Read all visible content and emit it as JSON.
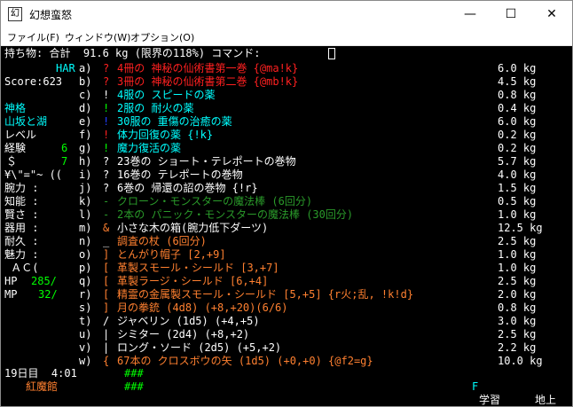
{
  "window": {
    "title": "幻想蛮怒",
    "icon": "app-icon"
  },
  "window_buttons": {
    "minimize": "—",
    "maximize": "☐",
    "close": "✕"
  },
  "menu": [
    "ファイル(F)",
    "ウィンドウ(W)",
    "オプション(O)"
  ],
  "header": {
    "text": "持ち物: 合計  91.6 kg (限界の118%) コマンド:"
  },
  "sidebar": {
    "race": "HAR",
    "score": "Score:623",
    "title": "神格",
    "name": "山坂と湖",
    "level_label": "レベル",
    "exp_label": "経験",
    "exp_value": "6",
    "gold_label": "＄",
    "gold_value": "7",
    "equip_chars": "¥\\\"=\"~ ((",
    "stats": [
      "腕力 :",
      "知能 :",
      "賢さ :",
      "器用 :",
      "耐久 :",
      "魅力 :"
    ],
    "ac_label": " ＡＣ(",
    "hp_label": "HP",
    "hp_value": "285/",
    "mp_label": "MP",
    "mp_value": "32/",
    "day": "19日目  4:01",
    "location": "紅魔館"
  },
  "inventory": [
    {
      "letter": "a)",
      "sym": "?",
      "sc": "rd",
      "name": "4冊の 神秘の仙術書第一巻 {@ma!k}",
      "nc": "rd",
      "weight": "6.0 kg"
    },
    {
      "letter": "b)",
      "sym": "?",
      "sc": "rd",
      "name": "3冊の 神秘の仙術書第二巻 {@mb!k}",
      "nc": "rd",
      "weight": "4.5 kg"
    },
    {
      "letter": "c)",
      "sym": "!",
      "sc": "w",
      "name": "4服の スピードの薬",
      "nc": "cy",
      "weight": "0.8 kg"
    },
    {
      "letter": "d)",
      "sym": "!",
      "sc": "gn",
      "name": "2服の 耐火の薬",
      "nc": "cy",
      "weight": "0.4 kg"
    },
    {
      "letter": "e)",
      "sym": "!",
      "sc": "bl",
      "name": "30服の 重傷の治癒の薬",
      "nc": "cy",
      "weight": "6.0 kg"
    },
    {
      "letter": "f)",
      "sym": "!",
      "sc": "rd",
      "name": "体力回復の薬 {!k}",
      "nc": "cy",
      "weight": "0.2 kg"
    },
    {
      "letter": "g)",
      "sym": "!",
      "sc": "gn",
      "name": "魔力復活の薬",
      "nc": "cy",
      "weight": "0.2 kg"
    },
    {
      "letter": "h)",
      "sym": "?",
      "sc": "w",
      "name": "23巻の ショート・テレポートの巻物",
      "nc": "w",
      "weight": "5.7 kg"
    },
    {
      "letter": "i)",
      "sym": "?",
      "sc": "w",
      "name": "16巻の テレポートの巻物",
      "nc": "w",
      "weight": "4.0 kg"
    },
    {
      "letter": "j)",
      "sym": "?",
      "sc": "w",
      "name": "6巻の 帰還の詔の巻物 {!r}",
      "nc": "w",
      "weight": "1.5 kg"
    },
    {
      "letter": "k)",
      "sym": "-",
      "sc": "dg",
      "name": "クローン・モンスターの魔法棒 (6回分)",
      "nc": "dg",
      "weight": "0.5 kg"
    },
    {
      "letter": "l)",
      "sym": "-",
      "sc": "dg",
      "name": "2本の パニック・モンスターの魔法棒 (30回分)",
      "nc": "dg",
      "weight": "1.0 kg"
    },
    {
      "letter": "m)",
      "sym": "&",
      "sc": "or",
      "name": "小さな木の箱(腕力低下ダーツ)",
      "nc": "w",
      "weight": "12.5 kg"
    },
    {
      "letter": "n)",
      "sym": "_",
      "sc": "w",
      "name": "調査の杖 (6回分)",
      "nc": "or",
      "weight": "2.5 kg"
    },
    {
      "letter": "o)",
      "sym": "]",
      "sc": "or",
      "name": "とんがり帽子 [2,+9]",
      "nc": "or",
      "weight": "1.0 kg"
    },
    {
      "letter": "p)",
      "sym": "[",
      "sc": "or",
      "name": "革製スモール・シールド [3,+7]",
      "nc": "or",
      "weight": "1.0 kg"
    },
    {
      "letter": "q)",
      "sym": "[",
      "sc": "or",
      "name": "革製ラージ・シールド [6,+4]",
      "nc": "or",
      "weight": "2.5 kg"
    },
    {
      "letter": "r)",
      "sym": "[",
      "sc": "or",
      "name": "精霊の金属製スモール・シールド [5,+5] {r火;乱, !k!d}",
      "nc": "or",
      "weight": "2.0 kg"
    },
    {
      "letter": "s)",
      "sym": "]",
      "sc": "or",
      "name": "月の拳銃 (4d8) (+8,+20)(6/6)",
      "nc": "or",
      "weight": "0.8 kg"
    },
    {
      "letter": "t)",
      "sym": "/",
      "sc": "w",
      "name": "ジャベリン (1d5) (+4,+5)",
      "nc": "w",
      "weight": "3.0 kg"
    },
    {
      "letter": "u)",
      "sym": "|",
      "sc": "w",
      "name": "シミター (2d4) (+8,+2)",
      "nc": "w",
      "weight": "2.5 kg"
    },
    {
      "letter": "v)",
      "sym": "|",
      "sc": "w",
      "name": "ロング・ソード (2d5) (+5,+2)",
      "nc": "w",
      "weight": "2.2 kg"
    },
    {
      "letter": "w)",
      "sym": "{",
      "sc": "or",
      "name": "67本の クロスボウの矢 (1d5) (+0,+0) {@f2=g}",
      "nc": "or",
      "weight": "10.0 kg"
    }
  ],
  "map": {
    "row1": "###",
    "row2": "###"
  },
  "status": {
    "flag": "F",
    "study": "学習",
    "depth": "地上"
  }
}
